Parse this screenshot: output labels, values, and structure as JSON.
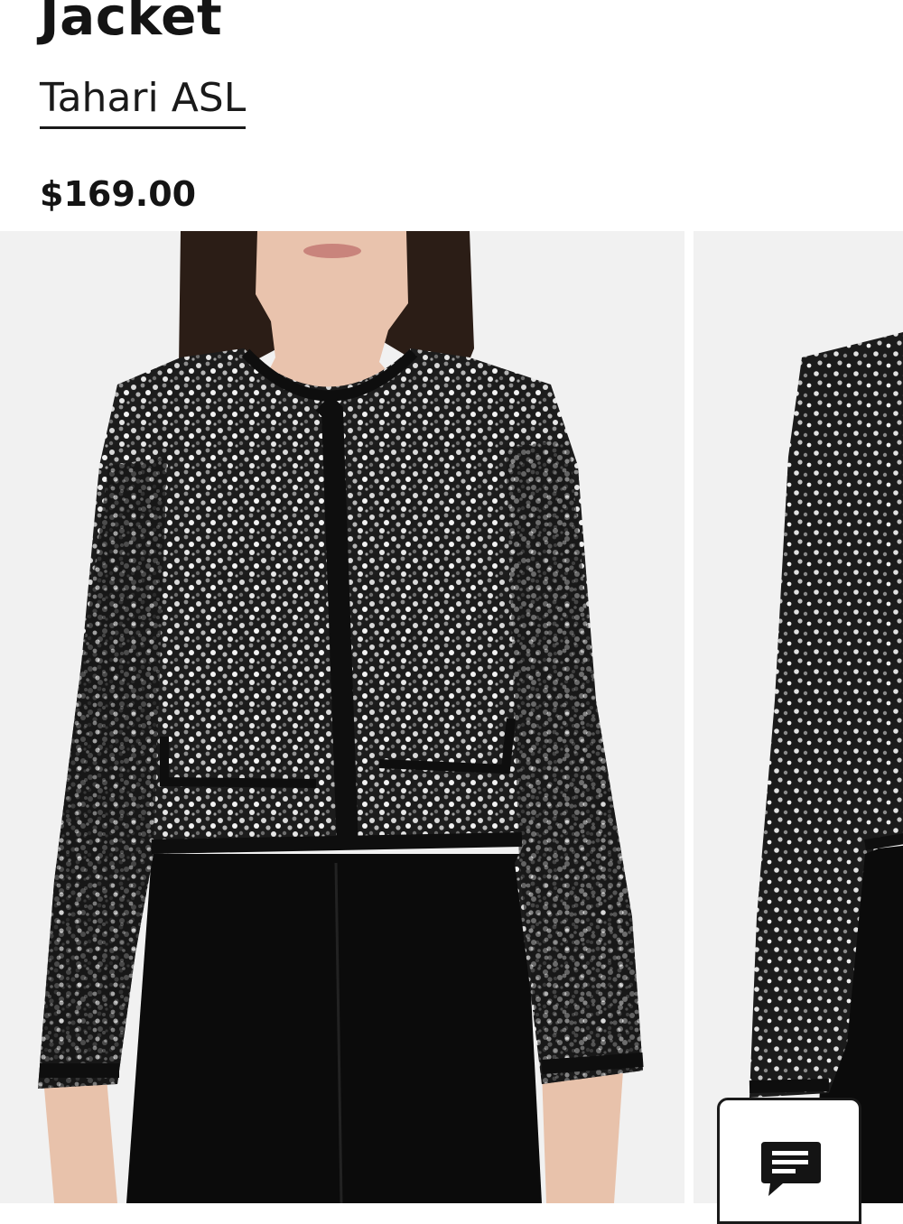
{
  "product": {
    "title": "Jacket",
    "brand": "Tahari ASL",
    "price": "$169.00"
  },
  "gallery": {
    "images": [
      {
        "icon": "product-photo-front"
      },
      {
        "icon": "product-photo-side"
      }
    ]
  },
  "chat": {
    "icon": "chat-icon"
  }
}
